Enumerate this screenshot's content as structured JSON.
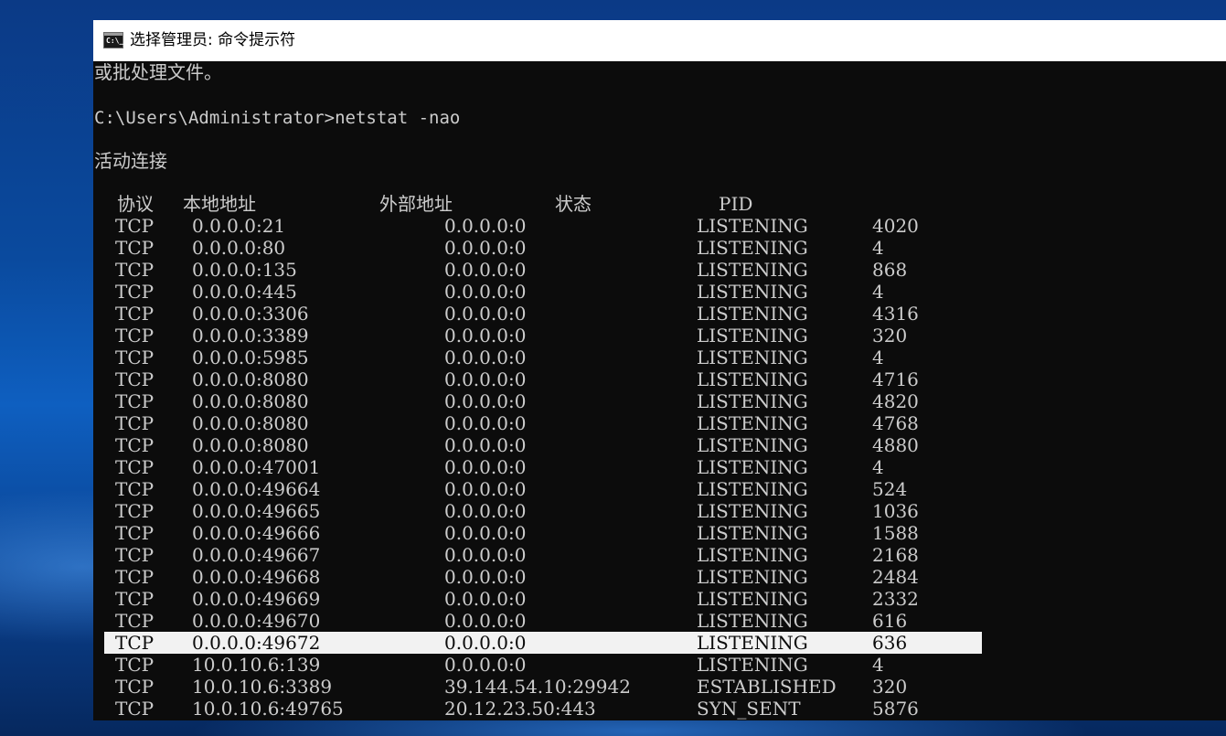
{
  "window": {
    "title": "选择管理员: 命令提示符",
    "icon_text": "C:\\_",
    "icon": "cmd-icon"
  },
  "console": {
    "line_prev": "或批处理文件。",
    "prompt_line": "C:\\Users\\Administrator>netstat -nao",
    "section_title": "活动连接",
    "headers": {
      "proto": "协议",
      "local": "本地地址",
      "foreign": "外部地址",
      "state": "状态",
      "pid": "PID"
    },
    "rows": [
      {
        "proto": "TCP",
        "local": "0.0.0.0:21",
        "foreign": "0.0.0.0:0",
        "state": "LISTENING",
        "pid": "4020"
      },
      {
        "proto": "TCP",
        "local": "0.0.0.0:80",
        "foreign": "0.0.0.0:0",
        "state": "LISTENING",
        "pid": "4"
      },
      {
        "proto": "TCP",
        "local": "0.0.0.0:135",
        "foreign": "0.0.0.0:0",
        "state": "LISTENING",
        "pid": "868"
      },
      {
        "proto": "TCP",
        "local": "0.0.0.0:445",
        "foreign": "0.0.0.0:0",
        "state": "LISTENING",
        "pid": "4"
      },
      {
        "proto": "TCP",
        "local": "0.0.0.0:3306",
        "foreign": "0.0.0.0:0",
        "state": "LISTENING",
        "pid": "4316"
      },
      {
        "proto": "TCP",
        "local": "0.0.0.0:3389",
        "foreign": "0.0.0.0:0",
        "state": "LISTENING",
        "pid": "320"
      },
      {
        "proto": "TCP",
        "local": "0.0.0.0:5985",
        "foreign": "0.0.0.0:0",
        "state": "LISTENING",
        "pid": "4"
      },
      {
        "proto": "TCP",
        "local": "0.0.0.0:8080",
        "foreign": "0.0.0.0:0",
        "state": "LISTENING",
        "pid": "4716"
      },
      {
        "proto": "TCP",
        "local": "0.0.0.0:8080",
        "foreign": "0.0.0.0:0",
        "state": "LISTENING",
        "pid": "4820"
      },
      {
        "proto": "TCP",
        "local": "0.0.0.0:8080",
        "foreign": "0.0.0.0:0",
        "state": "LISTENING",
        "pid": "4768"
      },
      {
        "proto": "TCP",
        "local": "0.0.0.0:8080",
        "foreign": "0.0.0.0:0",
        "state": "LISTENING",
        "pid": "4880"
      },
      {
        "proto": "TCP",
        "local": "0.0.0.0:47001",
        "foreign": "0.0.0.0:0",
        "state": "LISTENING",
        "pid": "4"
      },
      {
        "proto": "TCP",
        "local": "0.0.0.0:49664",
        "foreign": "0.0.0.0:0",
        "state": "LISTENING",
        "pid": "524"
      },
      {
        "proto": "TCP",
        "local": "0.0.0.0:49665",
        "foreign": "0.0.0.0:0",
        "state": "LISTENING",
        "pid": "1036"
      },
      {
        "proto": "TCP",
        "local": "0.0.0.0:49666",
        "foreign": "0.0.0.0:0",
        "state": "LISTENING",
        "pid": "1588"
      },
      {
        "proto": "TCP",
        "local": "0.0.0.0:49667",
        "foreign": "0.0.0.0:0",
        "state": "LISTENING",
        "pid": "2168"
      },
      {
        "proto": "TCP",
        "local": "0.0.0.0:49668",
        "foreign": "0.0.0.0:0",
        "state": "LISTENING",
        "pid": "2484"
      },
      {
        "proto": "TCP",
        "local": "0.0.0.0:49669",
        "foreign": "0.0.0.0:0",
        "state": "LISTENING",
        "pid": "2332"
      },
      {
        "proto": "TCP",
        "local": "0.0.0.0:49670",
        "foreign": "0.0.0.0:0",
        "state": "LISTENING",
        "pid": "616"
      },
      {
        "proto": "TCP",
        "local": "0.0.0.0:49672",
        "foreign": "0.0.0.0:0",
        "state": "LISTENING",
        "pid": "636",
        "selected": true
      },
      {
        "proto": "TCP",
        "local": "10.0.10.6:139",
        "foreign": "0.0.0.0:0",
        "state": "LISTENING",
        "pid": "4"
      },
      {
        "proto": "TCP",
        "local": "10.0.10.6:3389",
        "foreign": "39.144.54.10:29942",
        "state": "ESTABLISHED",
        "pid": "320"
      },
      {
        "proto": "TCP",
        "local": "10.0.10.6:49765",
        "foreign": "20.12.23.50:443",
        "state": "SYN_SENT",
        "pid": "5876"
      }
    ]
  },
  "colors": {
    "console_bg": "#0c0c0c",
    "console_fg": "#cccccc",
    "selection_bg": "#f2f2f2",
    "titlebar_bg": "#ffffff"
  }
}
